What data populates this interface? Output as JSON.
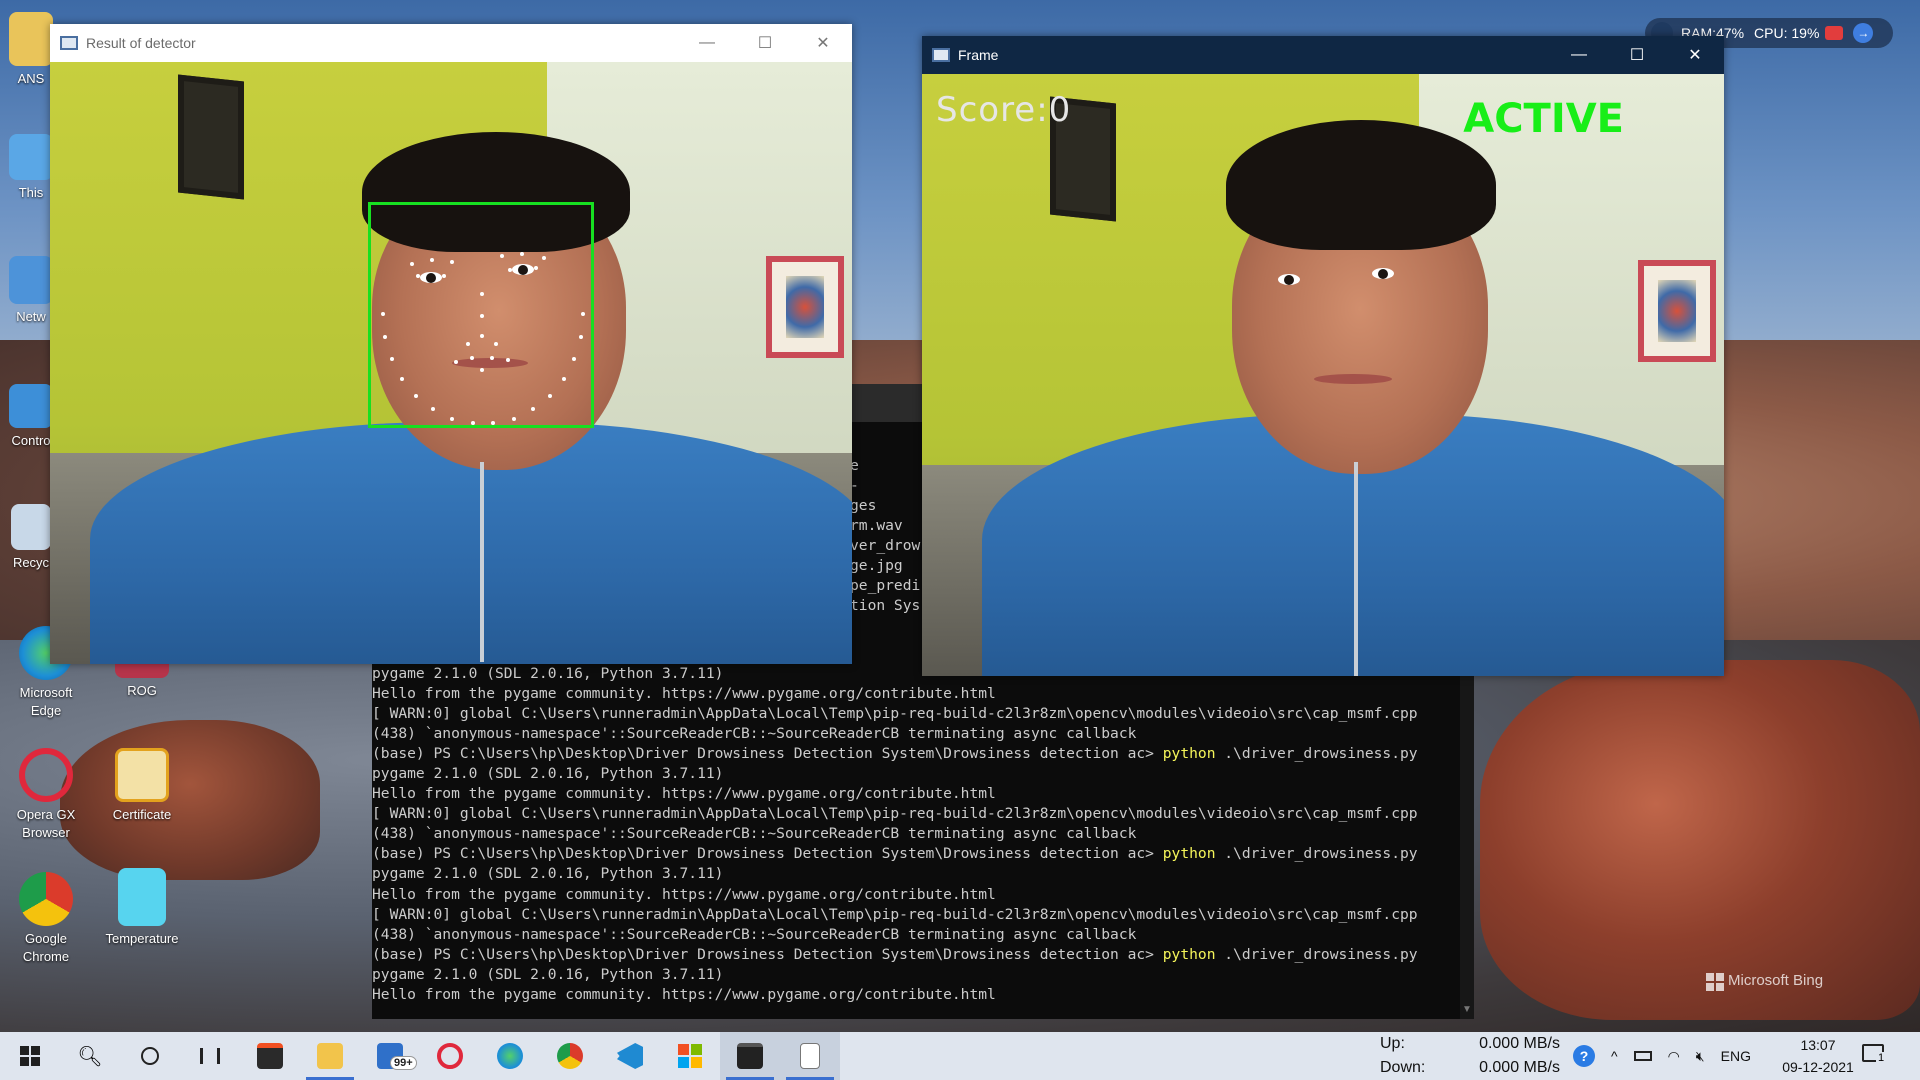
{
  "desktop": {
    "icons": [
      {
        "label": "ANS"
      },
      {
        "label": "This"
      },
      {
        "label": "Netw"
      },
      {
        "label": "Contro"
      },
      {
        "label": "Recyc"
      },
      {
        "label": "Microsoft Edge"
      },
      {
        "label": "ROG"
      },
      {
        "label": "Opera GX Browser"
      },
      {
        "label": "Certificate"
      },
      {
        "label": "Google Chrome"
      },
      {
        "label": "Temperature"
      }
    ],
    "watermark": "Microsoft Bing"
  },
  "sysmon": {
    "ram": "RAM:47%",
    "cpu": "CPU: 19%"
  },
  "detector_window": {
    "title": "Result of detector"
  },
  "frame_window": {
    "title": "Frame",
    "score_text": "Score:0",
    "status_text": "ACTIVE",
    "status_color": "#18ee18"
  },
  "window_controls": {
    "minimize": "—",
    "maximize": "☐",
    "close": "✕"
  },
  "terminal": {
    "peek_lines": [
      "e",
      "-",
      "ges",
      "rm.wav",
      "ver_drow",
      "ge.jpg",
      "pe_predi",
      "",
      "tion Sys"
    ],
    "lines": [
      {
        "text": "pygame 2.1.0 (SDL 2.0.16, Python 3.7.11)"
      },
      {
        "text": "Hello from the pygame community. https://www.pygame.org/contribute.html"
      },
      {
        "text": "[ WARN:0] global C:\\Users\\runneradmin\\AppData\\Local\\Temp\\pip-req-build-c2l3r8zm\\opencv\\modules\\videoio\\src\\cap_msmf.cpp"
      },
      {
        "text": "(438) `anonymous-namespace'::SourceReaderCB::~SourceReaderCB terminating async callback"
      },
      {
        "prompt": "(base) PS C:\\Users\\hp\\Desktop\\Driver Drowsiness Detection System\\Drowsiness detection ac> ",
        "cmd": "python",
        "rest": " .\\driver_drowsiness.py"
      },
      {
        "text": "pygame 2.1.0 (SDL 2.0.16, Python 3.7.11)"
      },
      {
        "text": "Hello from the pygame community. https://www.pygame.org/contribute.html"
      },
      {
        "text": "[ WARN:0] global C:\\Users\\runneradmin\\AppData\\Local\\Temp\\pip-req-build-c2l3r8zm\\opencv\\modules\\videoio\\src\\cap_msmf.cpp"
      },
      {
        "text": "(438) `anonymous-namespace'::SourceReaderCB::~SourceReaderCB terminating async callback"
      },
      {
        "prompt": "(base) PS C:\\Users\\hp\\Desktop\\Driver Drowsiness Detection System\\Drowsiness detection ac> ",
        "cmd": "python",
        "rest": " .\\driver_drowsiness.py"
      },
      {
        "text": "pygame 2.1.0 (SDL 2.0.16, Python 3.7.11)"
      },
      {
        "text": "Hello from the pygame community. https://www.pygame.org/contribute.html"
      },
      {
        "text": "[ WARN:0] global C:\\Users\\runneradmin\\AppData\\Local\\Temp\\pip-req-build-c2l3r8zm\\opencv\\modules\\videoio\\src\\cap_msmf.cpp"
      },
      {
        "text": "(438) `anonymous-namespace'::SourceReaderCB::~SourceReaderCB terminating async callback"
      },
      {
        "prompt": "(base) PS C:\\Users\\hp\\Desktop\\Driver Drowsiness Detection System\\Drowsiness detection ac> ",
        "cmd": "python",
        "rest": " .\\driver_drowsiness.py"
      },
      {
        "text": "pygame 2.1.0 (SDL 2.0.16, Python 3.7.11)"
      },
      {
        "text": "Hello from the pygame community. https://www.pygame.org/contribute.html"
      }
    ]
  },
  "taskbar": {
    "items": [
      "start-icon",
      "search-icon",
      "cortana-icon",
      "task-view-icon",
      "store-icon",
      "file-explorer-icon",
      "mail-icon",
      "opera-icon",
      "edge-icon",
      "chrome-icon",
      "vscode-icon",
      "microsoft-icon",
      "terminal-icon",
      "notepad-icon"
    ],
    "mail_badge": "99+",
    "net_up_label": "Up:",
    "net_up_value": "0.000 MB/s",
    "net_down_label": "Down:",
    "net_down_value": "0.000 MB/s",
    "language": "ENG",
    "time": "13:07",
    "date": "09-12-2021",
    "notifications_count": "1"
  }
}
